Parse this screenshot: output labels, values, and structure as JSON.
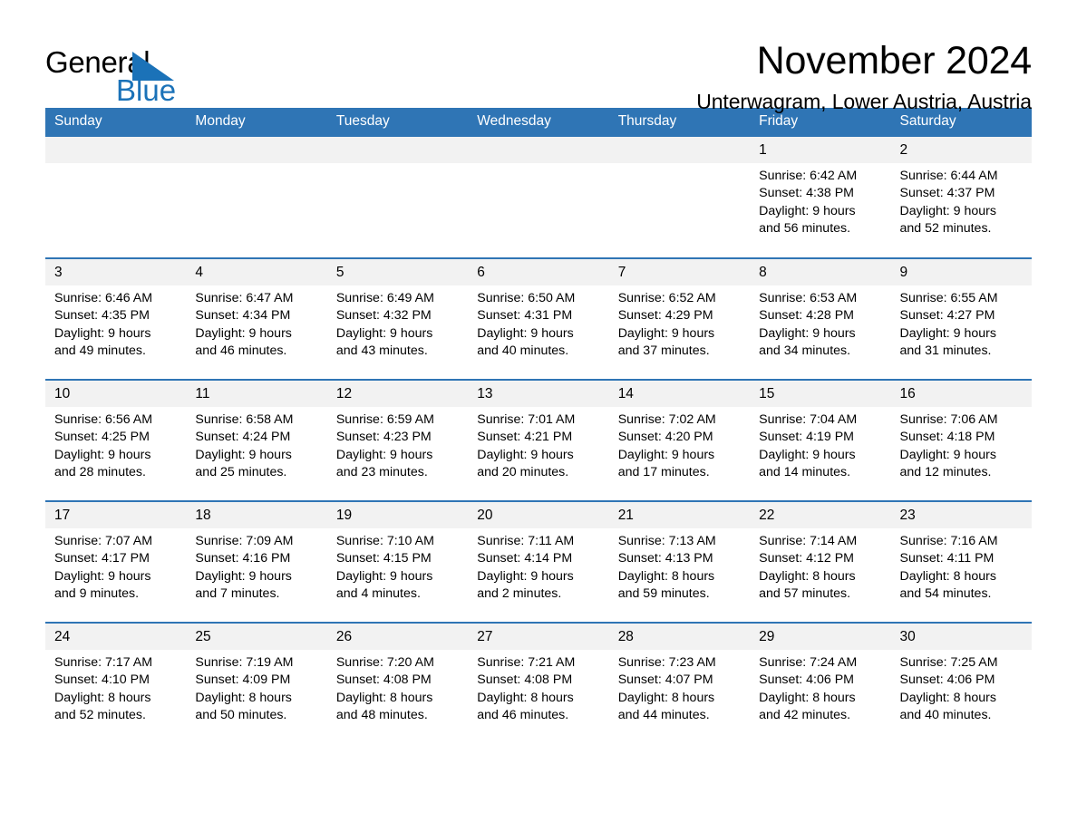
{
  "logo": {
    "word_general": "General",
    "word_blue": "Blue",
    "triangle_color": "#1b72b8"
  },
  "header": {
    "month_title": "November 2024",
    "location": "Unterwagram, Lower Austria, Austria"
  },
  "theme": {
    "header_blue": "#2f75b5",
    "daynum_bg": "#f2f2f2",
    "text": "#000000"
  },
  "calendar": {
    "weekday_headers": [
      "Sunday",
      "Monday",
      "Tuesday",
      "Wednesday",
      "Thursday",
      "Friday",
      "Saturday"
    ],
    "weeks": [
      [
        {
          "day": "",
          "sunrise": "",
          "sunset": "",
          "daylight_line1": "",
          "daylight_line2": ""
        },
        {
          "day": "",
          "sunrise": "",
          "sunset": "",
          "daylight_line1": "",
          "daylight_line2": ""
        },
        {
          "day": "",
          "sunrise": "",
          "sunset": "",
          "daylight_line1": "",
          "daylight_line2": ""
        },
        {
          "day": "",
          "sunrise": "",
          "sunset": "",
          "daylight_line1": "",
          "daylight_line2": ""
        },
        {
          "day": "",
          "sunrise": "",
          "sunset": "",
          "daylight_line1": "",
          "daylight_line2": ""
        },
        {
          "day": "1",
          "sunrise": "Sunrise: 6:42 AM",
          "sunset": "Sunset: 4:38 PM",
          "daylight_line1": "Daylight: 9 hours",
          "daylight_line2": "and 56 minutes."
        },
        {
          "day": "2",
          "sunrise": "Sunrise: 6:44 AM",
          "sunset": "Sunset: 4:37 PM",
          "daylight_line1": "Daylight: 9 hours",
          "daylight_line2": "and 52 minutes."
        }
      ],
      [
        {
          "day": "3",
          "sunrise": "Sunrise: 6:46 AM",
          "sunset": "Sunset: 4:35 PM",
          "daylight_line1": "Daylight: 9 hours",
          "daylight_line2": "and 49 minutes."
        },
        {
          "day": "4",
          "sunrise": "Sunrise: 6:47 AM",
          "sunset": "Sunset: 4:34 PM",
          "daylight_line1": "Daylight: 9 hours",
          "daylight_line2": "and 46 minutes."
        },
        {
          "day": "5",
          "sunrise": "Sunrise: 6:49 AM",
          "sunset": "Sunset: 4:32 PM",
          "daylight_line1": "Daylight: 9 hours",
          "daylight_line2": "and 43 minutes."
        },
        {
          "day": "6",
          "sunrise": "Sunrise: 6:50 AM",
          "sunset": "Sunset: 4:31 PM",
          "daylight_line1": "Daylight: 9 hours",
          "daylight_line2": "and 40 minutes."
        },
        {
          "day": "7",
          "sunrise": "Sunrise: 6:52 AM",
          "sunset": "Sunset: 4:29 PM",
          "daylight_line1": "Daylight: 9 hours",
          "daylight_line2": "and 37 minutes."
        },
        {
          "day": "8",
          "sunrise": "Sunrise: 6:53 AM",
          "sunset": "Sunset: 4:28 PM",
          "daylight_line1": "Daylight: 9 hours",
          "daylight_line2": "and 34 minutes."
        },
        {
          "day": "9",
          "sunrise": "Sunrise: 6:55 AM",
          "sunset": "Sunset: 4:27 PM",
          "daylight_line1": "Daylight: 9 hours",
          "daylight_line2": "and 31 minutes."
        }
      ],
      [
        {
          "day": "10",
          "sunrise": "Sunrise: 6:56 AM",
          "sunset": "Sunset: 4:25 PM",
          "daylight_line1": "Daylight: 9 hours",
          "daylight_line2": "and 28 minutes."
        },
        {
          "day": "11",
          "sunrise": "Sunrise: 6:58 AM",
          "sunset": "Sunset: 4:24 PM",
          "daylight_line1": "Daylight: 9 hours",
          "daylight_line2": "and 25 minutes."
        },
        {
          "day": "12",
          "sunrise": "Sunrise: 6:59 AM",
          "sunset": "Sunset: 4:23 PM",
          "daylight_line1": "Daylight: 9 hours",
          "daylight_line2": "and 23 minutes."
        },
        {
          "day": "13",
          "sunrise": "Sunrise: 7:01 AM",
          "sunset": "Sunset: 4:21 PM",
          "daylight_line1": "Daylight: 9 hours",
          "daylight_line2": "and 20 minutes."
        },
        {
          "day": "14",
          "sunrise": "Sunrise: 7:02 AM",
          "sunset": "Sunset: 4:20 PM",
          "daylight_line1": "Daylight: 9 hours",
          "daylight_line2": "and 17 minutes."
        },
        {
          "day": "15",
          "sunrise": "Sunrise: 7:04 AM",
          "sunset": "Sunset: 4:19 PM",
          "daylight_line1": "Daylight: 9 hours",
          "daylight_line2": "and 14 minutes."
        },
        {
          "day": "16",
          "sunrise": "Sunrise: 7:06 AM",
          "sunset": "Sunset: 4:18 PM",
          "daylight_line1": "Daylight: 9 hours",
          "daylight_line2": "and 12 minutes."
        }
      ],
      [
        {
          "day": "17",
          "sunrise": "Sunrise: 7:07 AM",
          "sunset": "Sunset: 4:17 PM",
          "daylight_line1": "Daylight: 9 hours",
          "daylight_line2": "and 9 minutes."
        },
        {
          "day": "18",
          "sunrise": "Sunrise: 7:09 AM",
          "sunset": "Sunset: 4:16 PM",
          "daylight_line1": "Daylight: 9 hours",
          "daylight_line2": "and 7 minutes."
        },
        {
          "day": "19",
          "sunrise": "Sunrise: 7:10 AM",
          "sunset": "Sunset: 4:15 PM",
          "daylight_line1": "Daylight: 9 hours",
          "daylight_line2": "and 4 minutes."
        },
        {
          "day": "20",
          "sunrise": "Sunrise: 7:11 AM",
          "sunset": "Sunset: 4:14 PM",
          "daylight_line1": "Daylight: 9 hours",
          "daylight_line2": "and 2 minutes."
        },
        {
          "day": "21",
          "sunrise": "Sunrise: 7:13 AM",
          "sunset": "Sunset: 4:13 PM",
          "daylight_line1": "Daylight: 8 hours",
          "daylight_line2": "and 59 minutes."
        },
        {
          "day": "22",
          "sunrise": "Sunrise: 7:14 AM",
          "sunset": "Sunset: 4:12 PM",
          "daylight_line1": "Daylight: 8 hours",
          "daylight_line2": "and 57 minutes."
        },
        {
          "day": "23",
          "sunrise": "Sunrise: 7:16 AM",
          "sunset": "Sunset: 4:11 PM",
          "daylight_line1": "Daylight: 8 hours",
          "daylight_line2": "and 54 minutes."
        }
      ],
      [
        {
          "day": "24",
          "sunrise": "Sunrise: 7:17 AM",
          "sunset": "Sunset: 4:10 PM",
          "daylight_line1": "Daylight: 8 hours",
          "daylight_line2": "and 52 minutes."
        },
        {
          "day": "25",
          "sunrise": "Sunrise: 7:19 AM",
          "sunset": "Sunset: 4:09 PM",
          "daylight_line1": "Daylight: 8 hours",
          "daylight_line2": "and 50 minutes."
        },
        {
          "day": "26",
          "sunrise": "Sunrise: 7:20 AM",
          "sunset": "Sunset: 4:08 PM",
          "daylight_line1": "Daylight: 8 hours",
          "daylight_line2": "and 48 minutes."
        },
        {
          "day": "27",
          "sunrise": "Sunrise: 7:21 AM",
          "sunset": "Sunset: 4:08 PM",
          "daylight_line1": "Daylight: 8 hours",
          "daylight_line2": "and 46 minutes."
        },
        {
          "day": "28",
          "sunrise": "Sunrise: 7:23 AM",
          "sunset": "Sunset: 4:07 PM",
          "daylight_line1": "Daylight: 8 hours",
          "daylight_line2": "and 44 minutes."
        },
        {
          "day": "29",
          "sunrise": "Sunrise: 7:24 AM",
          "sunset": "Sunset: 4:06 PM",
          "daylight_line1": "Daylight: 8 hours",
          "daylight_line2": "and 42 minutes."
        },
        {
          "day": "30",
          "sunrise": "Sunrise: 7:25 AM",
          "sunset": "Sunset: 4:06 PM",
          "daylight_line1": "Daylight: 8 hours",
          "daylight_line2": "and 40 minutes."
        }
      ]
    ]
  }
}
